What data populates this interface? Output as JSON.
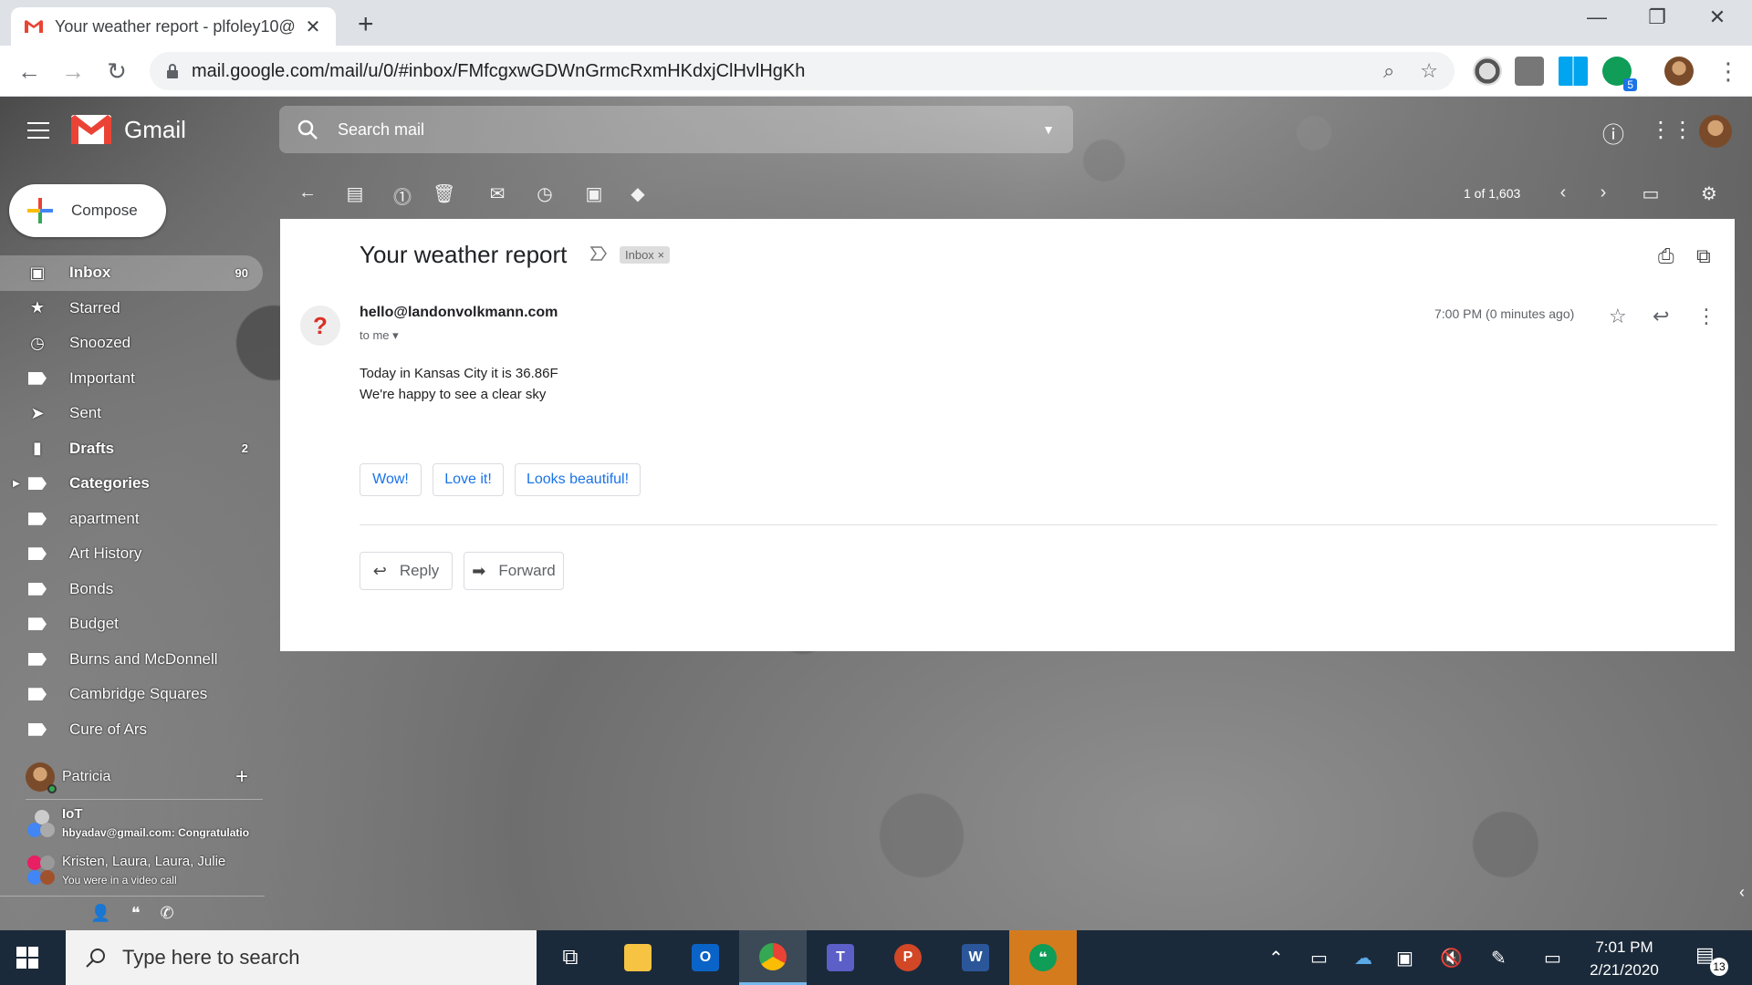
{
  "browser": {
    "tab_title": "Your weather report - plfoley10@",
    "url": "mail.google.com/mail/u/0/#inbox/FMfcgxwGDWnGrmcRxmHKdxjClHvlHgKh",
    "extension_badge": "5"
  },
  "gmail": {
    "logo_text": "Gmail",
    "search_placeholder": "Search mail",
    "compose_label": "Compose",
    "pager": "1 of 1,603"
  },
  "sidebar": {
    "items": [
      {
        "label": "Inbox",
        "count": "90"
      },
      {
        "label": "Starred",
        "count": ""
      },
      {
        "label": "Snoozed",
        "count": ""
      },
      {
        "label": "Important",
        "count": ""
      },
      {
        "label": "Sent",
        "count": ""
      },
      {
        "label": "Drafts",
        "count": "2"
      },
      {
        "label": "Categories",
        "count": ""
      },
      {
        "label": "apartment",
        "count": ""
      },
      {
        "label": "Art History",
        "count": ""
      },
      {
        "label": "Bonds",
        "count": ""
      },
      {
        "label": "Budget",
        "count": ""
      },
      {
        "label": "Burns and McDonnell",
        "count": ""
      },
      {
        "label": "Cambridge Squares",
        "count": ""
      },
      {
        "label": "Cure of Ars",
        "count": ""
      }
    ]
  },
  "hangouts": {
    "user": "Patricia",
    "chats": [
      {
        "title": "IoT",
        "subtitle": "hbyadav@gmail.com: Congratulatio"
      },
      {
        "title": "Kristen, Laura, Laura, Julie",
        "subtitle": "You were in a video call"
      }
    ]
  },
  "message": {
    "subject": "Your weather report",
    "label_chip": "Inbox",
    "label_chip_close": "×",
    "sender": "hello@landonvolkmann.com",
    "recipient": "to me",
    "time": "7:00 PM (0 minutes ago)",
    "avatar_glyph": "?",
    "body_line1": "Today in Kansas City it is 36.86F",
    "body_line2": "We're happy to see a clear sky",
    "smart_replies": [
      "Wow!",
      "Love it!",
      "Looks beautiful!"
    ],
    "reply_label": "Reply",
    "forward_label": "Forward"
  },
  "taskbar": {
    "search_placeholder": "Type here to search",
    "time": "7:01 PM",
    "date": "2/21/2020",
    "notification_count": "13"
  },
  "colors": {
    "gmail_red": "#ea4335",
    "link_blue": "#1a73e8",
    "taskbar": "#1b2a3a"
  }
}
